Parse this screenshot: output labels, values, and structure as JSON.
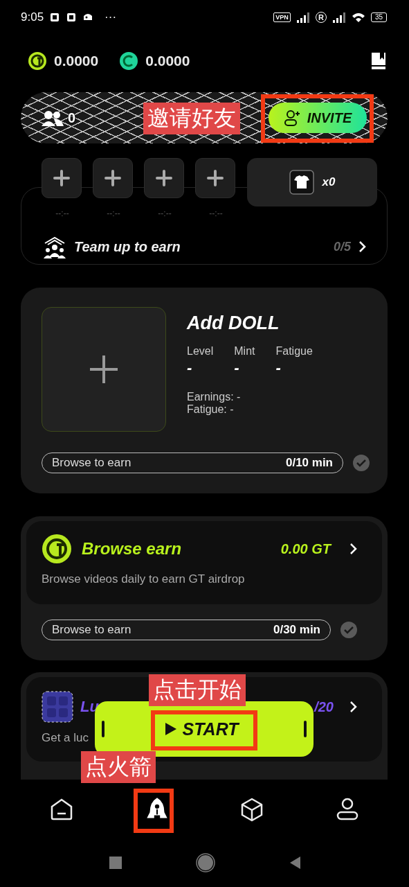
{
  "status_bar": {
    "time": "9:05",
    "more": "···",
    "vpn": "VPN",
    "roaming": "R",
    "battery": "35"
  },
  "balances": [
    {
      "kind": "gt",
      "amount": "0.0000"
    },
    {
      "kind": "coin",
      "amount": "0.0000"
    }
  ],
  "invite_banner": {
    "friends": "0",
    "button": "INVITE"
  },
  "team": {
    "slots": [
      {
        "time": "--:--"
      },
      {
        "time": "--:--"
      },
      {
        "time": "--:--"
      },
      {
        "time": "--:--"
      }
    ],
    "shirts": "x0",
    "title": "Team up to earn",
    "progress": "0/5",
    "level": 0
  },
  "doll_card": {
    "title": "Add DOLL",
    "stats": [
      {
        "label": "Level",
        "value": "-"
      },
      {
        "label": "Mint",
        "value": "-"
      },
      {
        "label": "Fatigue",
        "value": "-"
      }
    ],
    "earnings": "Earnings: -",
    "fatigue": "Fatigue: -",
    "task": {
      "label": "Browse to earn",
      "progress": "0/10 min",
      "level": 0
    }
  },
  "browse_card": {
    "title": "Browse earn",
    "amount": "0.00 GT",
    "description": "Browse videos daily to earn GT airdrop",
    "task": {
      "label": "Browse to earn",
      "progress": "0/30 min",
      "level": 0
    }
  },
  "lucky_card": {
    "title": "Lu",
    "progress": "/20",
    "level": 0,
    "description": "Get a luc"
  },
  "start_button": {
    "label": "START"
  },
  "nav": [
    {
      "kind": "home",
      "selected": false
    },
    {
      "kind": "rocket",
      "selected": true
    },
    {
      "kind": "cube",
      "selected": false
    },
    {
      "kind": "user",
      "selected": false
    }
  ],
  "annotations": [
    {
      "text": "邀请好友"
    },
    {
      "text": "点击开始"
    },
    {
      "text": "点火箭"
    }
  ]
}
